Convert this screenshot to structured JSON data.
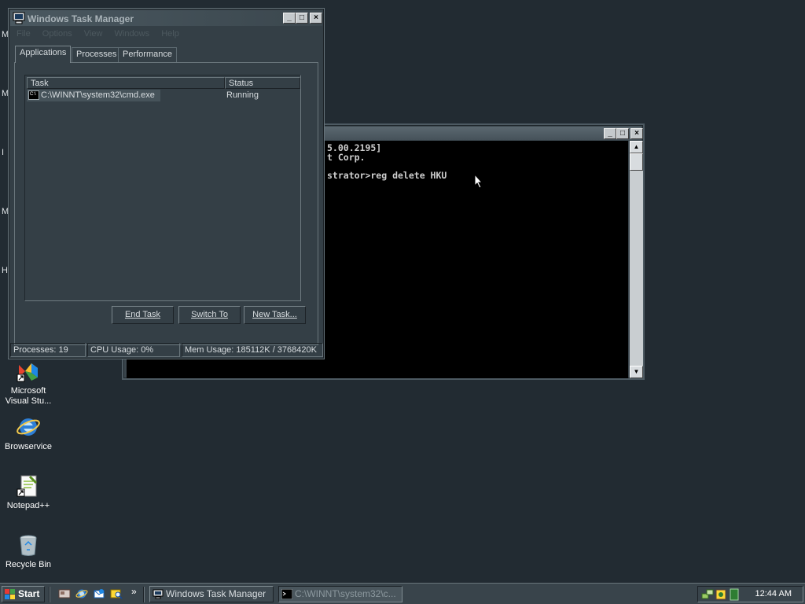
{
  "desktop": {
    "partial_icon_letters": [
      "M",
      "M",
      "I",
      "M",
      "H"
    ],
    "icons": [
      {
        "label": "Microsoft Visual Stu..."
      },
      {
        "label": "Browservice"
      },
      {
        "label": "Notepad++"
      },
      {
        "label": "Recycle Bin"
      }
    ]
  },
  "cmd_window": {
    "console_lines": [
      "5.00.2195]",
      "t Corp.",
      "",
      "strator>reg delete HKU"
    ],
    "buttons": {
      "minimize": "_",
      "maximize": "□",
      "close": "×"
    }
  },
  "task_manager": {
    "title": "Windows Task Manager",
    "title_buttons": {
      "minimize": "_",
      "maximize": "□",
      "close": "×"
    },
    "menu": [
      "File",
      "Options",
      "View",
      "Windows",
      "Help"
    ],
    "tabs": [
      "Applications",
      "Processes",
      "Performance"
    ],
    "active_tab": "Applications",
    "columns": {
      "task": "Task",
      "status": "Status"
    },
    "rows": [
      {
        "task": "C:\\WINNT\\system32\\cmd.exe",
        "status": "Running"
      }
    ],
    "buttons": {
      "end_task": "End Task",
      "switch_to": "Switch To",
      "new_task": "New Task..."
    },
    "status_bar": {
      "processes": "Processes: 19",
      "cpu": "CPU Usage: 0%",
      "mem": "Mem Usage: 185112K / 3768420K"
    }
  },
  "taskbar": {
    "start_label": "Start",
    "overflow_chevron": "»",
    "tasks": [
      {
        "label": "Windows Task Manager"
      },
      {
        "label": "C:\\WINNT\\system32\\c..."
      }
    ],
    "clock": "12:44 AM"
  },
  "colors": {
    "desktop": "#222b32",
    "window_bg": "#343f46",
    "console_bg": "#000000"
  }
}
